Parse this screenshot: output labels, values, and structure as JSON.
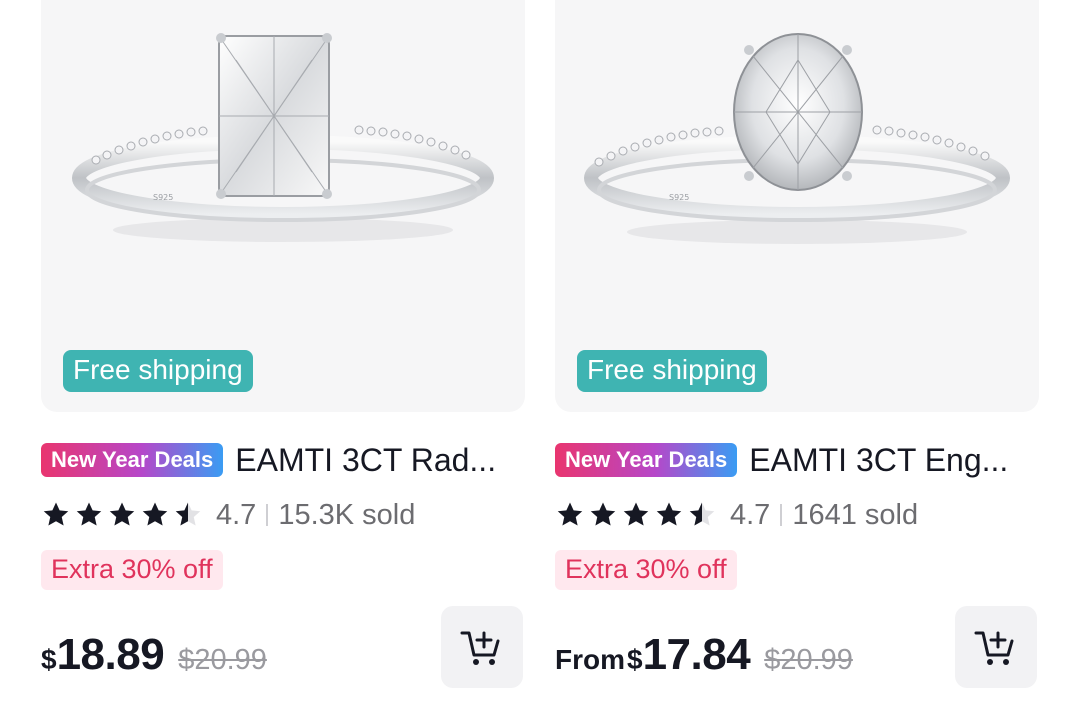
{
  "products": [
    {
      "free_shipping": "Free shipping",
      "deal_badge": "New Year Deals",
      "title": "EAMTI 3CT Rad...",
      "rating": "4.7",
      "rating_value": 4.7,
      "sold": "15.3K sold",
      "extra_badge": "Extra 30% off",
      "price_prefix": "",
      "currency": "$",
      "price": "18.89",
      "original_price": "$20.99",
      "stone_shape": "radiant"
    },
    {
      "free_shipping": "Free shipping",
      "deal_badge": "New Year Deals",
      "title": "EAMTI 3CT Eng...",
      "rating": "4.7",
      "rating_value": 4.7,
      "sold": "1641 sold",
      "extra_badge": "Extra 30% off",
      "price_prefix": "From",
      "currency": "$",
      "price": "17.84",
      "original_price": "$20.99",
      "stone_shape": "oval"
    }
  ],
  "icons": {
    "star": "star-icon",
    "half_star": "half-star-icon",
    "cart": "add-to-cart-icon"
  },
  "colors": {
    "free_shipping_bg": "#3fb4b2",
    "extra_badge_text": "#e0335c",
    "extra_badge_bg": "#ffe8ee"
  }
}
